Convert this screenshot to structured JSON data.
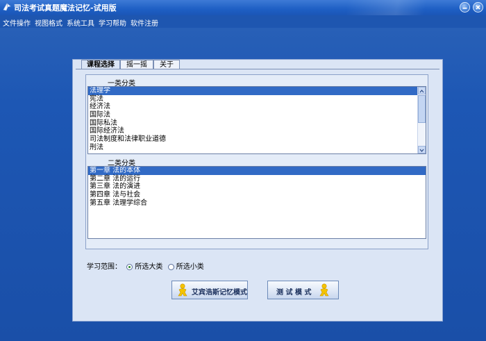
{
  "window": {
    "title": "司法考试真题魔法记忆-试用版"
  },
  "menu": [
    {
      "label": "文件操作"
    },
    {
      "label": "视图格式"
    },
    {
      "label": "系统工具"
    },
    {
      "label": "学习帮助"
    },
    {
      "label": "软件注册"
    }
  ],
  "tabs": [
    {
      "label": "课程选择"
    },
    {
      "label": "摇一摇"
    },
    {
      "label": "关于"
    }
  ],
  "category1": {
    "label": "一类分类",
    "items": [
      "法理学",
      "宪法",
      "经济法",
      "国际法",
      "国际私法",
      "国际经济法",
      "司法制度和法律职业道德",
      "刑法"
    ],
    "selected_index": 0
  },
  "category2": {
    "label": "二类分类",
    "items": [
      "第一章 法的本体",
      "第二章 法的运行",
      "第三章 法的演进",
      "第四章 法与社会",
      "第五章 法理学综合"
    ],
    "selected_index": 0
  },
  "scope": {
    "label": "学习范围：",
    "options": [
      {
        "label": "所选大类",
        "checked": true
      },
      {
        "label": "所选小类",
        "checked": false
      }
    ]
  },
  "buttons": {
    "ebbinghaus": "艾宾浩斯记忆模式",
    "test": "测 试 模 式"
  },
  "colors": {
    "background": "#1d57b4",
    "selection": "#316ac5",
    "panel": "#dbe5f5"
  },
  "icons": {
    "app": "app-icon",
    "minimize": "minimize-icon",
    "close": "close-icon",
    "mascot": "mascot-figure-icon"
  }
}
